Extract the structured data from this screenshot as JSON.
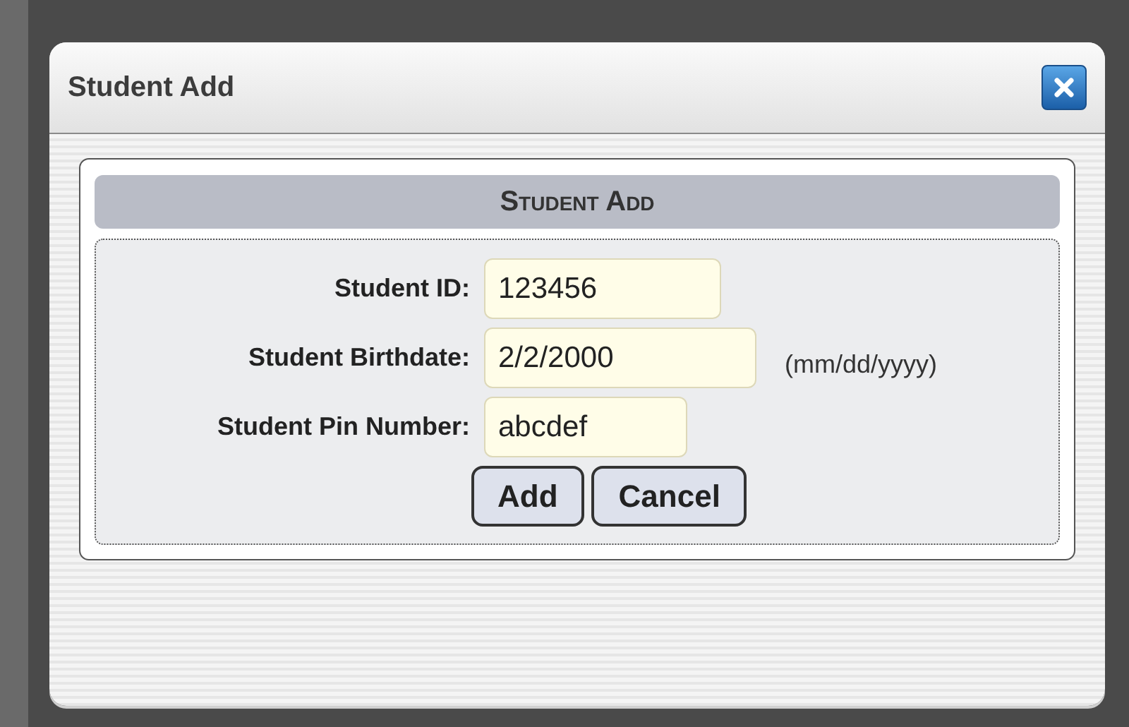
{
  "window": {
    "title": "Student Add"
  },
  "form": {
    "heading": "Student Add",
    "fields": [
      {
        "label": "Student ID:",
        "value": "123456"
      },
      {
        "label": "Student Birthdate:",
        "value": "2/2/2000",
        "hint": "(mm/dd/yyyy)"
      },
      {
        "label": "Student Pin Number:",
        "value": "abcdef"
      }
    ],
    "buttons": [
      "Add",
      "Cancel"
    ]
  }
}
